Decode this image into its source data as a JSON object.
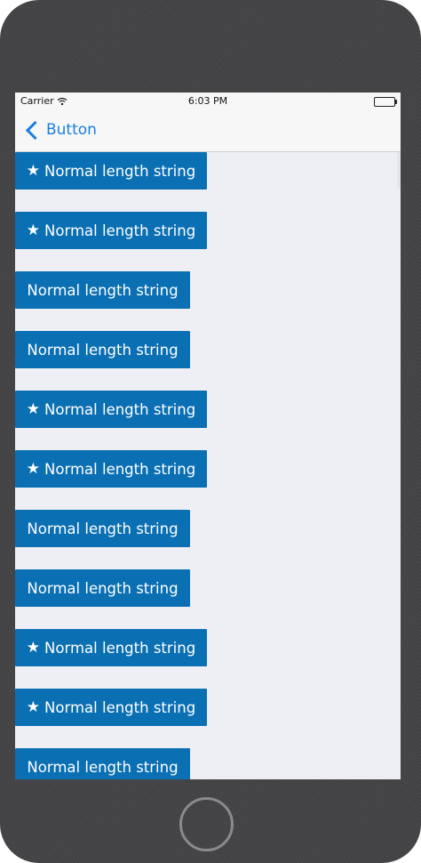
{
  "status_bar": {
    "carrier": "Carrier",
    "time": "6:03 PM"
  },
  "nav": {
    "back_label": "Button"
  },
  "buttons": [
    {
      "label": "Normal length string",
      "starred": true
    },
    {
      "label": "Normal length string",
      "starred": true
    },
    {
      "label": "Normal length string",
      "starred": false
    },
    {
      "label": "Normal length string",
      "starred": false
    },
    {
      "label": "Normal length string",
      "starred": true
    },
    {
      "label": "Normal length string",
      "starred": true
    },
    {
      "label": "Normal length string",
      "starred": false
    },
    {
      "label": "Normal length string",
      "starred": false
    },
    {
      "label": "Normal length string",
      "starred": true
    },
    {
      "label": "Normal length string",
      "starred": true
    },
    {
      "label": "Normal length string",
      "starred": false
    }
  ],
  "icons": {
    "star": "★"
  },
  "colors": {
    "button_bg": "#0a6fb3",
    "tint": "#1a7fdc",
    "background": "#eeeff4"
  }
}
